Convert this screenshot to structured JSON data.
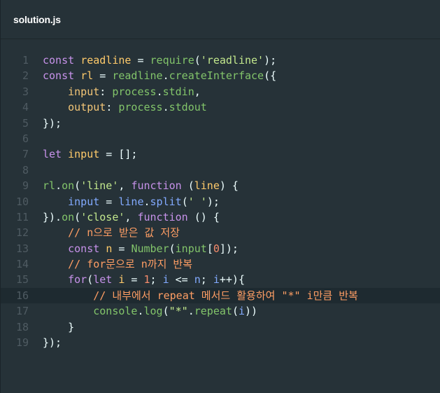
{
  "file": {
    "title": "solution.js"
  },
  "lines": [
    {
      "n": "1",
      "tokens": [
        [
          "kw",
          "const "
        ],
        [
          "var",
          "readline"
        ],
        [
          "pr",
          " = "
        ],
        [
          "obj",
          "require"
        ],
        [
          "pr",
          "("
        ],
        [
          "str",
          "'readline'"
        ],
        [
          "pr",
          ");"
        ]
      ]
    },
    {
      "n": "2",
      "tokens": [
        [
          "kw",
          "const "
        ],
        [
          "var",
          "rl"
        ],
        [
          "pr",
          " = "
        ],
        [
          "obj",
          "readline"
        ],
        [
          "pr",
          "."
        ],
        [
          "obj",
          "createInterface"
        ],
        [
          "pr",
          "({"
        ]
      ]
    },
    {
      "n": "3",
      "tokens": [
        [
          "pr",
          "    "
        ],
        [
          "prop",
          "input"
        ],
        [
          "pr",
          ": "
        ],
        [
          "obj",
          "process"
        ],
        [
          "pr",
          "."
        ],
        [
          "obj",
          "stdin"
        ],
        [
          "pr",
          ","
        ]
      ]
    },
    {
      "n": "4",
      "tokens": [
        [
          "pr",
          "    "
        ],
        [
          "prop",
          "output"
        ],
        [
          "pr",
          ": "
        ],
        [
          "obj",
          "process"
        ],
        [
          "pr",
          "."
        ],
        [
          "obj",
          "stdout"
        ]
      ]
    },
    {
      "n": "5",
      "tokens": [
        [
          "pr",
          "});"
        ]
      ]
    },
    {
      "n": "6",
      "tokens": []
    },
    {
      "n": "7",
      "tokens": [
        [
          "kw",
          "let "
        ],
        [
          "var",
          "input"
        ],
        [
          "pr",
          " = [];"
        ]
      ]
    },
    {
      "n": "8",
      "tokens": []
    },
    {
      "n": "9",
      "tokens": [
        [
          "obj",
          "rl"
        ],
        [
          "pr",
          "."
        ],
        [
          "obj",
          "on"
        ],
        [
          "pr",
          "("
        ],
        [
          "str",
          "'line'"
        ],
        [
          "pr",
          ", "
        ],
        [
          "kw",
          "function"
        ],
        [
          "pr",
          " ("
        ],
        [
          "var",
          "line"
        ],
        [
          "pr",
          ") {"
        ]
      ]
    },
    {
      "n": "10",
      "tokens": [
        [
          "pr",
          "    "
        ],
        [
          "fn",
          "input"
        ],
        [
          "pr",
          " = "
        ],
        [
          "fn",
          "line"
        ],
        [
          "pr",
          "."
        ],
        [
          "fn",
          "split"
        ],
        [
          "pr",
          "("
        ],
        [
          "str",
          "' '"
        ],
        [
          "pr",
          ");"
        ]
      ]
    },
    {
      "n": "11",
      "tokens": [
        [
          "pr",
          "})."
        ],
        [
          "obj",
          "on"
        ],
        [
          "pr",
          "("
        ],
        [
          "str",
          "'close'"
        ],
        [
          "pr",
          ", "
        ],
        [
          "kw",
          "function"
        ],
        [
          "pr",
          " () {"
        ]
      ]
    },
    {
      "n": "12",
      "tokens": [
        [
          "pr",
          "    "
        ],
        [
          "cm",
          "// n으로 받은 값 저장"
        ]
      ]
    },
    {
      "n": "13",
      "tokens": [
        [
          "pr",
          "    "
        ],
        [
          "kw",
          "const "
        ],
        [
          "var",
          "n"
        ],
        [
          "pr",
          " = "
        ],
        [
          "obj",
          "Number"
        ],
        [
          "pr",
          "("
        ],
        [
          "obj",
          "input"
        ],
        [
          "pr",
          "["
        ],
        [
          "num",
          "0"
        ],
        [
          "pr",
          "]);"
        ]
      ]
    },
    {
      "n": "14",
      "tokens": [
        [
          "pr",
          "    "
        ],
        [
          "cm",
          "// for문으로 n까지 반복"
        ]
      ]
    },
    {
      "n": "15",
      "tokens": [
        [
          "pr",
          "    "
        ],
        [
          "kw",
          "for"
        ],
        [
          "pr",
          "("
        ],
        [
          "kw",
          "let "
        ],
        [
          "var",
          "i"
        ],
        [
          "pr",
          " = "
        ],
        [
          "num",
          "1"
        ],
        [
          "pr",
          "; "
        ],
        [
          "fn",
          "i"
        ],
        [
          "pr",
          " <= "
        ],
        [
          "fn",
          "n"
        ],
        [
          "pr",
          "; "
        ],
        [
          "fn",
          "i"
        ],
        [
          "pr",
          "++){"
        ]
      ]
    },
    {
      "n": "16",
      "active": true,
      "tokens": [
        [
          "pr",
          "        "
        ],
        [
          "cm",
          "// 내부에서 repeat 메서드 활용하여 \"*\" i만큼 반복"
        ]
      ]
    },
    {
      "n": "17",
      "tokens": [
        [
          "pr",
          "        "
        ],
        [
          "obj",
          "console"
        ],
        [
          "pr",
          "."
        ],
        [
          "obj",
          "log"
        ],
        [
          "pr",
          "("
        ],
        [
          "str",
          "\"*\""
        ],
        [
          "pr",
          "."
        ],
        [
          "obj",
          "repeat"
        ],
        [
          "pr",
          "("
        ],
        [
          "fn",
          "i"
        ],
        [
          "pr",
          "))"
        ]
      ]
    },
    {
      "n": "18",
      "tokens": [
        [
          "pr",
          "    }"
        ]
      ]
    },
    {
      "n": "19",
      "tokens": [
        [
          "pr",
          "});"
        ]
      ]
    }
  ]
}
